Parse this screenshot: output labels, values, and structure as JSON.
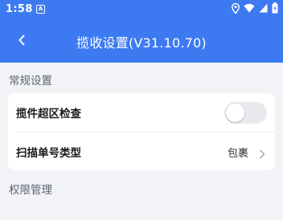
{
  "status_bar": {
    "time": "1:58",
    "notification_letter": "A",
    "icons": [
      "location-icon",
      "wifi-icon",
      "signal-icon",
      "battery-icon"
    ]
  },
  "app_bar": {
    "title": "揽收设置(V31.10.70)",
    "back_icon": "chevron-left-icon"
  },
  "sections": {
    "general": {
      "header": "常规设置",
      "items": [
        {
          "label": "揽件超区检查",
          "type": "toggle",
          "enabled": false
        },
        {
          "label": "扫描单号类型",
          "type": "select",
          "value": "包裹"
        }
      ]
    },
    "permissions": {
      "header": "权限管理"
    }
  },
  "colors": {
    "primary": "#3d7af2",
    "background": "#f2f3f7",
    "card": "#ffffff",
    "toggle_off": "#e8e9ed"
  }
}
